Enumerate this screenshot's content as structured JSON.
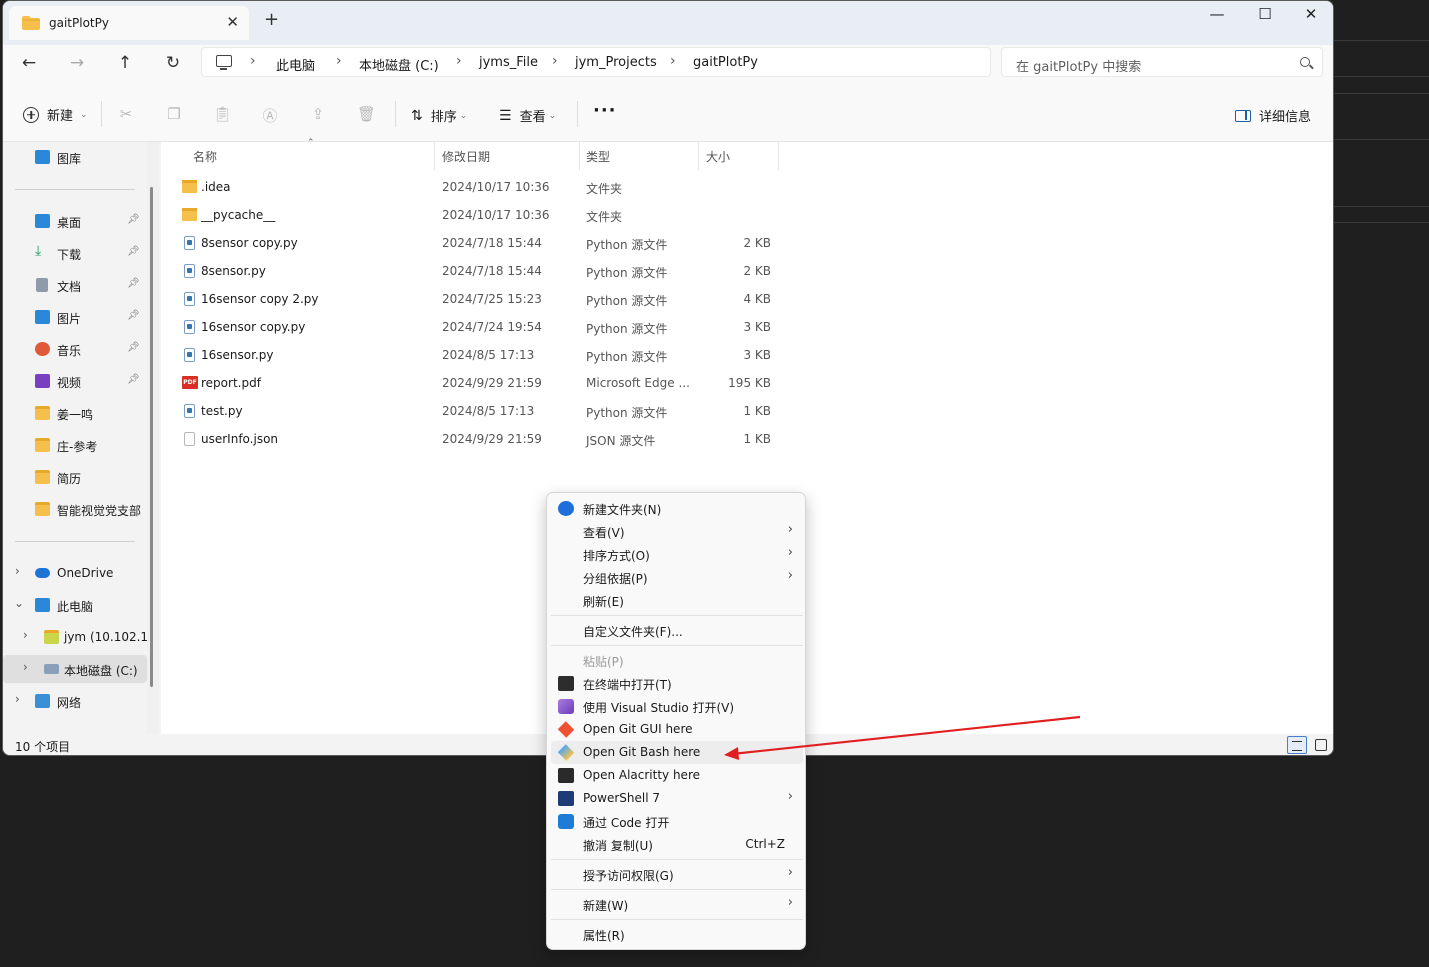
{
  "window": {
    "tab_title": "gaitPlotPy",
    "new_tab": "+",
    "tab_close": "✕"
  },
  "address": {
    "breadcrumb": [
      "此电脑",
      "本地磁盘 (C:)",
      "jyms_File",
      "jym_Projects",
      "gaitPlotPy"
    ],
    "search_placeholder": "在 gaitPlotPy 中搜索"
  },
  "toolbar": {
    "new_label": "新建",
    "sort_label": "排序",
    "view_label": "查看",
    "more_label": "···",
    "details_label": "详细信息"
  },
  "sidebar": {
    "gallery": "图库",
    "pinned": [
      {
        "label": "桌面",
        "icon": "desktop-icon",
        "color": "#2b88d8"
      },
      {
        "label": "下载",
        "icon": "download-icon",
        "color": "#1a9c5b"
      },
      {
        "label": "文档",
        "icon": "document-icon",
        "color": "#6b7a8f"
      },
      {
        "label": "图片",
        "icon": "pictures-icon",
        "color": "#2b88d8"
      },
      {
        "label": "音乐",
        "icon": "music-icon",
        "color": "#e05a3a"
      },
      {
        "label": "视频",
        "icon": "video-icon",
        "color": "#7a3fc0"
      }
    ],
    "folders": [
      "姜一鸣",
      "庄-参考",
      "简历",
      "智能视觉党支部"
    ],
    "tree": {
      "onedrive": "OneDrive",
      "this_pc": "此电脑",
      "network_drive": "jym (10.102.1",
      "local_disk": "本地磁盘 (C:)",
      "network": "网络"
    }
  },
  "columns": {
    "name": "名称",
    "date": "修改日期",
    "type": "类型",
    "size": "大小"
  },
  "files": [
    {
      "name": ".idea",
      "date": "2024/10/17 10:36",
      "type": "文件夹",
      "size": "",
      "kind": "folder"
    },
    {
      "name": "__pycache__",
      "date": "2024/10/17 10:36",
      "type": "文件夹",
      "size": "",
      "kind": "folder"
    },
    {
      "name": "8sensor copy.py",
      "date": "2024/7/18 15:44",
      "type": "Python 源文件",
      "size": "2 KB",
      "kind": "py"
    },
    {
      "name": "8sensor.py",
      "date": "2024/7/18 15:44",
      "type": "Python 源文件",
      "size": "2 KB",
      "kind": "py"
    },
    {
      "name": "16sensor copy 2.py",
      "date": "2024/7/25 15:23",
      "type": "Python 源文件",
      "size": "4 KB",
      "kind": "py"
    },
    {
      "name": "16sensor copy.py",
      "date": "2024/7/24 19:54",
      "type": "Python 源文件",
      "size": "3 KB",
      "kind": "py"
    },
    {
      "name": "16sensor.py",
      "date": "2024/8/5 17:13",
      "type": "Python 源文件",
      "size": "3 KB",
      "kind": "py"
    },
    {
      "name": "report.pdf",
      "date": "2024/9/29 21:59",
      "type": "Microsoft Edge ...",
      "size": "195 KB",
      "kind": "pdf"
    },
    {
      "name": "test.py",
      "date": "2024/8/5 17:13",
      "type": "Python 源文件",
      "size": "1 KB",
      "kind": "py"
    },
    {
      "name": "userInfo.json",
      "date": "2024/9/29 21:59",
      "type": "JSON 源文件",
      "size": "1 KB",
      "kind": "json"
    }
  ],
  "status": {
    "item_count": "10 个项目"
  },
  "context_menu": {
    "new_folder": "新建文件夹(N)",
    "view": "查看(V)",
    "sort_by": "排序方式(O)",
    "group_by": "分组依据(P)",
    "refresh": "刷新(E)",
    "customize": "自定义文件夹(F)...",
    "paste": "粘贴(P)",
    "open_terminal": "在终端中打开(T)",
    "open_vs": "使用 Visual Studio 打开(V)",
    "git_gui": "Open Git GUI here",
    "git_bash": "Open Git Bash here",
    "alacritty": "Open Alacritty here",
    "powershell": "PowerShell 7",
    "open_code": "通过 Code 打开",
    "undo_copy": "撤消 复制(U)",
    "undo_shortcut": "Ctrl+Z",
    "grant_access": "授予访问权限(G)",
    "new": "新建(W)",
    "properties": "属性(R)"
  },
  "colors": {
    "accent": "#1f5fa8",
    "annotation_arrow": "#e02020"
  }
}
